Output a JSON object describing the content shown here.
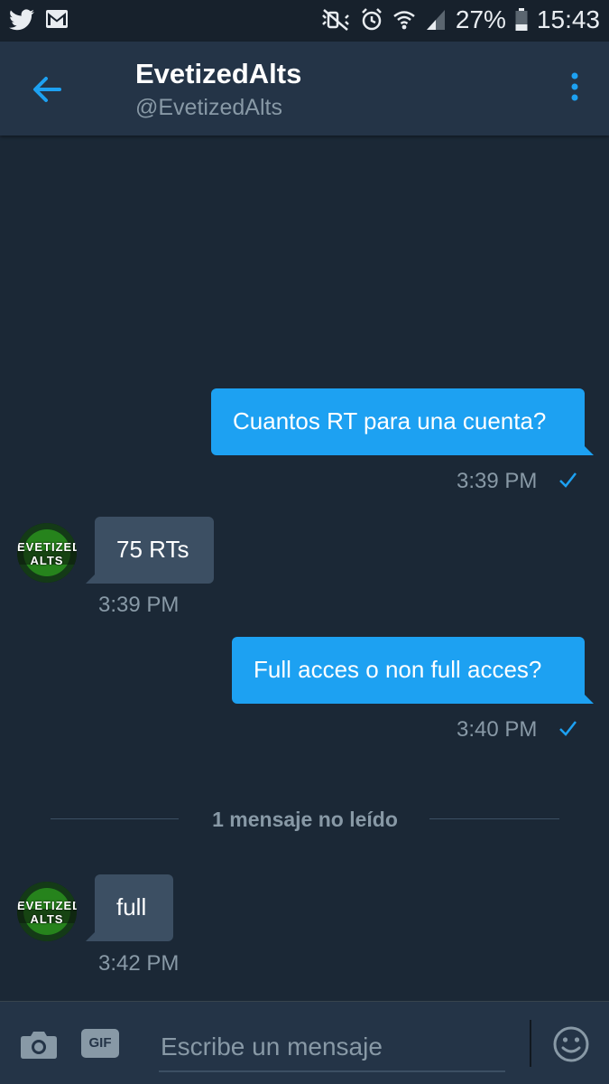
{
  "status_bar": {
    "battery_text": "27%",
    "clock": "15:43",
    "icons": [
      "twitter-icon",
      "gmail-icon",
      "mute-icon",
      "alarm-icon",
      "wifi-icon",
      "signal-icon",
      "battery-icon"
    ]
  },
  "header": {
    "title": "EvetizedAlts",
    "handle": "@EvetizedAlts"
  },
  "messages": [
    {
      "direction": "out",
      "text": "Cuantos RT para una cuenta?",
      "time": "3:39 PM",
      "read": true
    },
    {
      "direction": "in",
      "text": "75 RTs",
      "time": "3:39 PM"
    },
    {
      "direction": "out",
      "text": "Full acces o non full acces?",
      "time": "3:40 PM",
      "read": true
    },
    {
      "direction": "in",
      "text": "full",
      "time": "3:42 PM"
    }
  ],
  "unread_divider": "1 mensaje no leído",
  "avatar_text": "EVETIZED ALTS",
  "compose": {
    "gif_label": "GIF",
    "placeholder": "Escribe un mensaje"
  },
  "colors": {
    "background": "#1b2836",
    "header": "#243447",
    "accent": "#1da1f2",
    "incoming_bubble": "#3c4f63",
    "muted_text": "#8899a6"
  }
}
